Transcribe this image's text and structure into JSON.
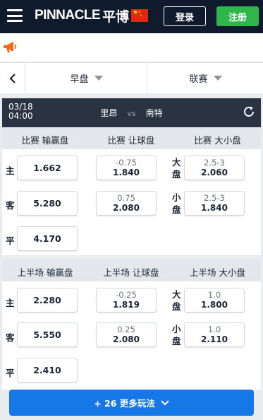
{
  "header": {
    "logo_text": "PINNACLE",
    "logo_cn": "平博",
    "login_label": "登录",
    "register_label": "注册",
    "flag": "china-flag",
    "colors": {
      "background": "#0f1a2d",
      "register": "#2fb64a"
    }
  },
  "filters": {
    "market_dropdown": "早盘",
    "league_dropdown": "联赛"
  },
  "match": {
    "date": "03/18",
    "time": "04:00",
    "home": "里昂",
    "vs": "vs",
    "away": "南特"
  },
  "full_time": {
    "headers": [
      "比赛 输赢盘",
      "比赛 让球盘",
      "比赛 大小盘"
    ],
    "moneyline": [
      {
        "label": "主",
        "price": "1.662"
      },
      {
        "label": "客",
        "price": "5.280"
      },
      {
        "label": "平",
        "price": "4.170"
      }
    ],
    "handicap": [
      {
        "line": "-0.75",
        "price": "1.840"
      },
      {
        "line": "0.75",
        "price": "2.080"
      }
    ],
    "totals": [
      {
        "label": "大盘",
        "line": "2.5-3",
        "price": "2.060"
      },
      {
        "label": "小盘",
        "line": "2.5-3",
        "price": "1.840"
      }
    ]
  },
  "first_half": {
    "headers": [
      "上半场 输赢盘",
      "上半场 让球盘",
      "上半场 大小盘"
    ],
    "moneyline": [
      {
        "label": "主",
        "price": "2.280"
      },
      {
        "label": "客",
        "price": "5.550"
      },
      {
        "label": "平",
        "price": "2.410"
      }
    ],
    "handicap": [
      {
        "line": "-0.25",
        "price": "1.819"
      },
      {
        "line": "0.25",
        "price": "2.080"
      }
    ],
    "totals": [
      {
        "label": "大盘",
        "line": "1.0",
        "price": "1.800"
      },
      {
        "label": "小盘",
        "line": "1.0",
        "price": "2.110"
      }
    ]
  },
  "more_button": {
    "label": "+ 26 更多玩法",
    "color": "#1677e6"
  }
}
